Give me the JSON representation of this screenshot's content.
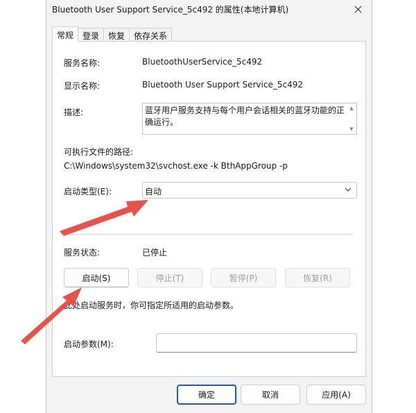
{
  "window": {
    "title": "Bluetooth User Support Service_5c492 的属性(本地计算机)"
  },
  "tabs": [
    {
      "label": "常规"
    },
    {
      "label": "登录"
    },
    {
      "label": "恢复"
    },
    {
      "label": "依存关系"
    }
  ],
  "general": {
    "service_name_label": "服务名称:",
    "service_name_value": "BluetoothUserService_5c492",
    "display_name_label": "显示名称:",
    "display_name_value": "Bluetooth User Support Service_5c492",
    "description_label": "描述:",
    "description_value": "蓝牙用户服务支持与每个用户会话相关的蓝牙功能的正确运行。",
    "exe_path_label": "可执行文件的路径:",
    "exe_path_value": "C:\\Windows\\system32\\svchost.exe -k BthAppGroup -p",
    "startup_type_label": "启动类型(E):",
    "startup_type_value": "自动",
    "status_label": "服务状态:",
    "status_value": "已停止",
    "start_button": "启动(S)",
    "stop_button": "停止(T)",
    "pause_button": "暂停(P)",
    "resume_button": "恢复(R)",
    "hint_text": "此处启动服务时，你可指定所适用的启动参数。",
    "start_params_label": "启动参数(M):",
    "start_params_value": ""
  },
  "footer": {
    "ok_button": "确定",
    "cancel_button": "取消",
    "apply_button": "应用(A)"
  },
  "annotation_color": "#e8524a"
}
